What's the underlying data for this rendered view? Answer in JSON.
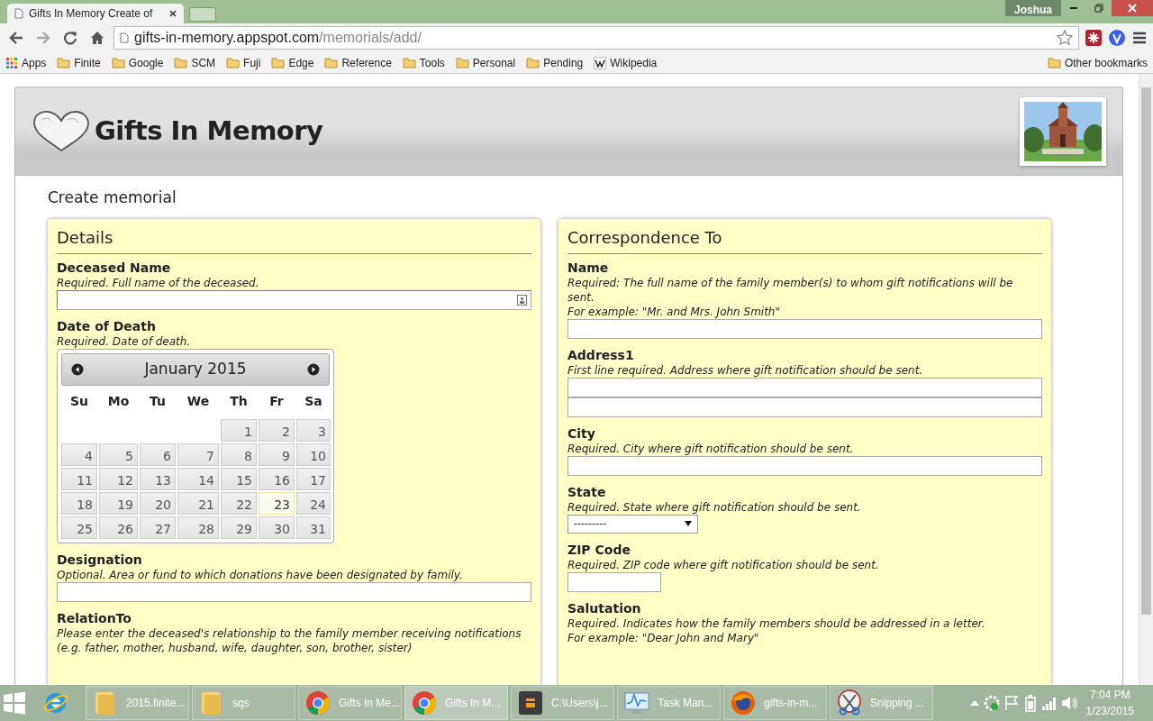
{
  "browser": {
    "tab_title": "Gifts In Memory Create of",
    "user": "Joshua",
    "url_host": "gifts-in-memory.appspot.com",
    "url_path": "/memorials/add/",
    "bookmarks": [
      {
        "label": "Apps",
        "kind": "apps"
      },
      {
        "label": "Finite",
        "kind": "folder"
      },
      {
        "label": "Google",
        "kind": "folder"
      },
      {
        "label": "SCM",
        "kind": "folder"
      },
      {
        "label": "Fuji",
        "kind": "folder"
      },
      {
        "label": "Edge",
        "kind": "folder"
      },
      {
        "label": "Reference",
        "kind": "folder"
      },
      {
        "label": "Tools",
        "kind": "folder"
      },
      {
        "label": "Personal",
        "kind": "folder"
      },
      {
        "label": "Pending",
        "kind": "folder"
      },
      {
        "label": "Wikipedia",
        "kind": "wiki"
      }
    ],
    "other_bookmarks": "Other bookmarks"
  },
  "site_title": "Gifts In Memory",
  "heading": "Create memorial",
  "details": {
    "title": "Details",
    "fields": [
      {
        "label": "Deceased Name",
        "help": [
          "Required. Full name of the deceased."
        ],
        "kind": "text"
      },
      {
        "label": "Date of Death",
        "help": [
          "Required. Date of death."
        ],
        "kind": "date"
      },
      {
        "label": "Designation",
        "help": [
          "Optional. Area or fund to which donations have been designated by family."
        ],
        "kind": "text"
      },
      {
        "label": "RelationTo",
        "help": [
          "Please enter the deceased's relationship to the family member receiving notifications",
          "(e.g. father, mother, husband, wife, daughter, son, brother, sister)"
        ],
        "kind": "none"
      }
    ]
  },
  "calendar": {
    "month": "January 2015",
    "weekdays": [
      "Su",
      "Mo",
      "Tu",
      "We",
      "Th",
      "Fr",
      "Sa"
    ],
    "weeks": [
      [
        {
          "day": "1",
          "today": false
        },
        {
          "day": "2",
          "today": false
        },
        {
          "day": "3",
          "today": false
        }
      ],
      [
        {
          "day": "4",
          "today": false
        },
        {
          "day": "5",
          "today": false
        },
        {
          "day": "6",
          "today": false
        },
        {
          "day": "7",
          "today": false
        },
        {
          "day": "8",
          "today": false
        },
        {
          "day": "9",
          "today": false
        },
        {
          "day": "10",
          "today": false
        }
      ],
      [
        {
          "day": "11",
          "today": false
        },
        {
          "day": "12",
          "today": false
        },
        {
          "day": "13",
          "today": false
        },
        {
          "day": "14",
          "today": false
        },
        {
          "day": "15",
          "today": false
        },
        {
          "day": "16",
          "today": false
        },
        {
          "day": "17",
          "today": false
        }
      ],
      [
        {
          "day": "18",
          "today": false
        },
        {
          "day": "19",
          "today": false
        },
        {
          "day": "20",
          "today": false
        },
        {
          "day": "21",
          "today": false
        },
        {
          "day": "22",
          "today": false
        },
        {
          "day": "23",
          "today": true
        },
        {
          "day": "24",
          "today": false
        }
      ],
      [
        {
          "day": "25",
          "today": false
        },
        {
          "day": "26",
          "today": false
        },
        {
          "day": "27",
          "today": false
        },
        {
          "day": "28",
          "today": false
        },
        {
          "day": "29",
          "today": false
        },
        {
          "day": "30",
          "today": false
        },
        {
          "day": "31",
          "today": false
        }
      ]
    ]
  },
  "correspondence": {
    "title": "Correspondence To",
    "fields": [
      {
        "label": "Name",
        "help": [
          "Required: The full name of the family member(s) to whom gift notifications will be sent.",
          "For example: \"Mr. and Mrs. John Smith\""
        ],
        "kind": "text"
      },
      {
        "label": "Address1",
        "help": [
          "First line required. Address where gift notification should be sent."
        ],
        "kind": "double"
      },
      {
        "label": "City",
        "help": [
          "Required. City where gift notification should be sent."
        ],
        "kind": "text"
      },
      {
        "label": "State",
        "help": [
          "Required. State where gift notification should be sent."
        ],
        "kind": "select",
        "value": "---------"
      },
      {
        "label": "ZIP Code",
        "help": [
          "Required. ZIP code where gift notification should be sent."
        ],
        "kind": "short"
      },
      {
        "label": "Salutation",
        "help": [
          "Required. Indicates how the family members should be addressed in a letter.",
          "For example: \"Dear John and Mary\""
        ],
        "kind": "none"
      }
    ]
  },
  "taskbar": {
    "items": [
      {
        "kind": "ie",
        "selected": false
      },
      {
        "label": "2015.finite...",
        "kind": "folder",
        "selected": false
      },
      {
        "label": "sqs",
        "kind": "folder",
        "selected": false
      },
      {
        "label": "Gifts In Me...",
        "kind": "chrome",
        "selected": false
      },
      {
        "label": "Gifts In M...",
        "kind": "chrome",
        "selected": true
      },
      {
        "label": "C:\\Users\\j...",
        "kind": "sublime",
        "selected": false
      },
      {
        "label": "Task Man...",
        "kind": "monitor",
        "selected": false
      },
      {
        "label": "gifts-in-m...",
        "kind": "firefox",
        "selected": false
      },
      {
        "label": "Snipping ...",
        "kind": "scissors",
        "selected": false
      }
    ],
    "time": "7:04 PM",
    "date": "1/23/2015"
  }
}
